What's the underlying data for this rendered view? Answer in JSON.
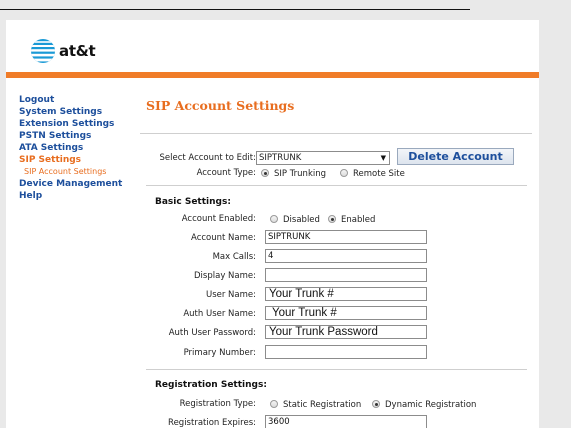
{
  "brand": {
    "logo_text": "at&t",
    "accent": "#f07c28",
    "link_color": "#1d4f9c",
    "logo_icon": "att-globe-icon"
  },
  "sidebar": {
    "items": [
      {
        "label": "Logout"
      },
      {
        "label": "System Settings"
      },
      {
        "label": "Extension Settings"
      },
      {
        "label": "PSTN Settings"
      },
      {
        "label": "ATA Settings"
      },
      {
        "label": "SIP Settings"
      },
      {
        "label": "SIP Account Settings"
      },
      {
        "label": "Device Management"
      },
      {
        "label": "Help"
      }
    ]
  },
  "main": {
    "title": "SIP Account Settings",
    "select_account": {
      "label": "Select Account to Edit:",
      "value": "SIPTRUNK"
    },
    "delete_button": "Delete Account",
    "account_type": {
      "label": "Account Type:",
      "option1": "SIP Trunking",
      "option2": "Remote Site"
    },
    "basic": {
      "heading": "Basic Settings:",
      "account_enabled": {
        "label": "Account Enabled:",
        "option1": "Disabled",
        "option2": "Enabled"
      },
      "account_name": {
        "label": "Account Name:",
        "value": "SIPTRUNK"
      },
      "max_calls": {
        "label": "Max Calls:",
        "value": "4"
      },
      "display_name": {
        "label": "Display Name:",
        "value": ""
      },
      "user_name": {
        "label": "User Name:",
        "value": "Your Trunk #"
      },
      "auth_user_name": {
        "label": "Auth User Name:",
        "value": " Your Trunk #"
      },
      "auth_user_password": {
        "label": "Auth User Password:",
        "value": "Your Trunk Password"
      },
      "primary_number": {
        "label": "Primary Number:",
        "value": ""
      }
    },
    "registration": {
      "heading": "Registration Settings:",
      "type": {
        "label": "Registration Type:",
        "option1": "Static Registration",
        "option2": "Dynamic Registration"
      },
      "expires": {
        "label": "Registration Expires:",
        "value": "3600"
      }
    }
  }
}
